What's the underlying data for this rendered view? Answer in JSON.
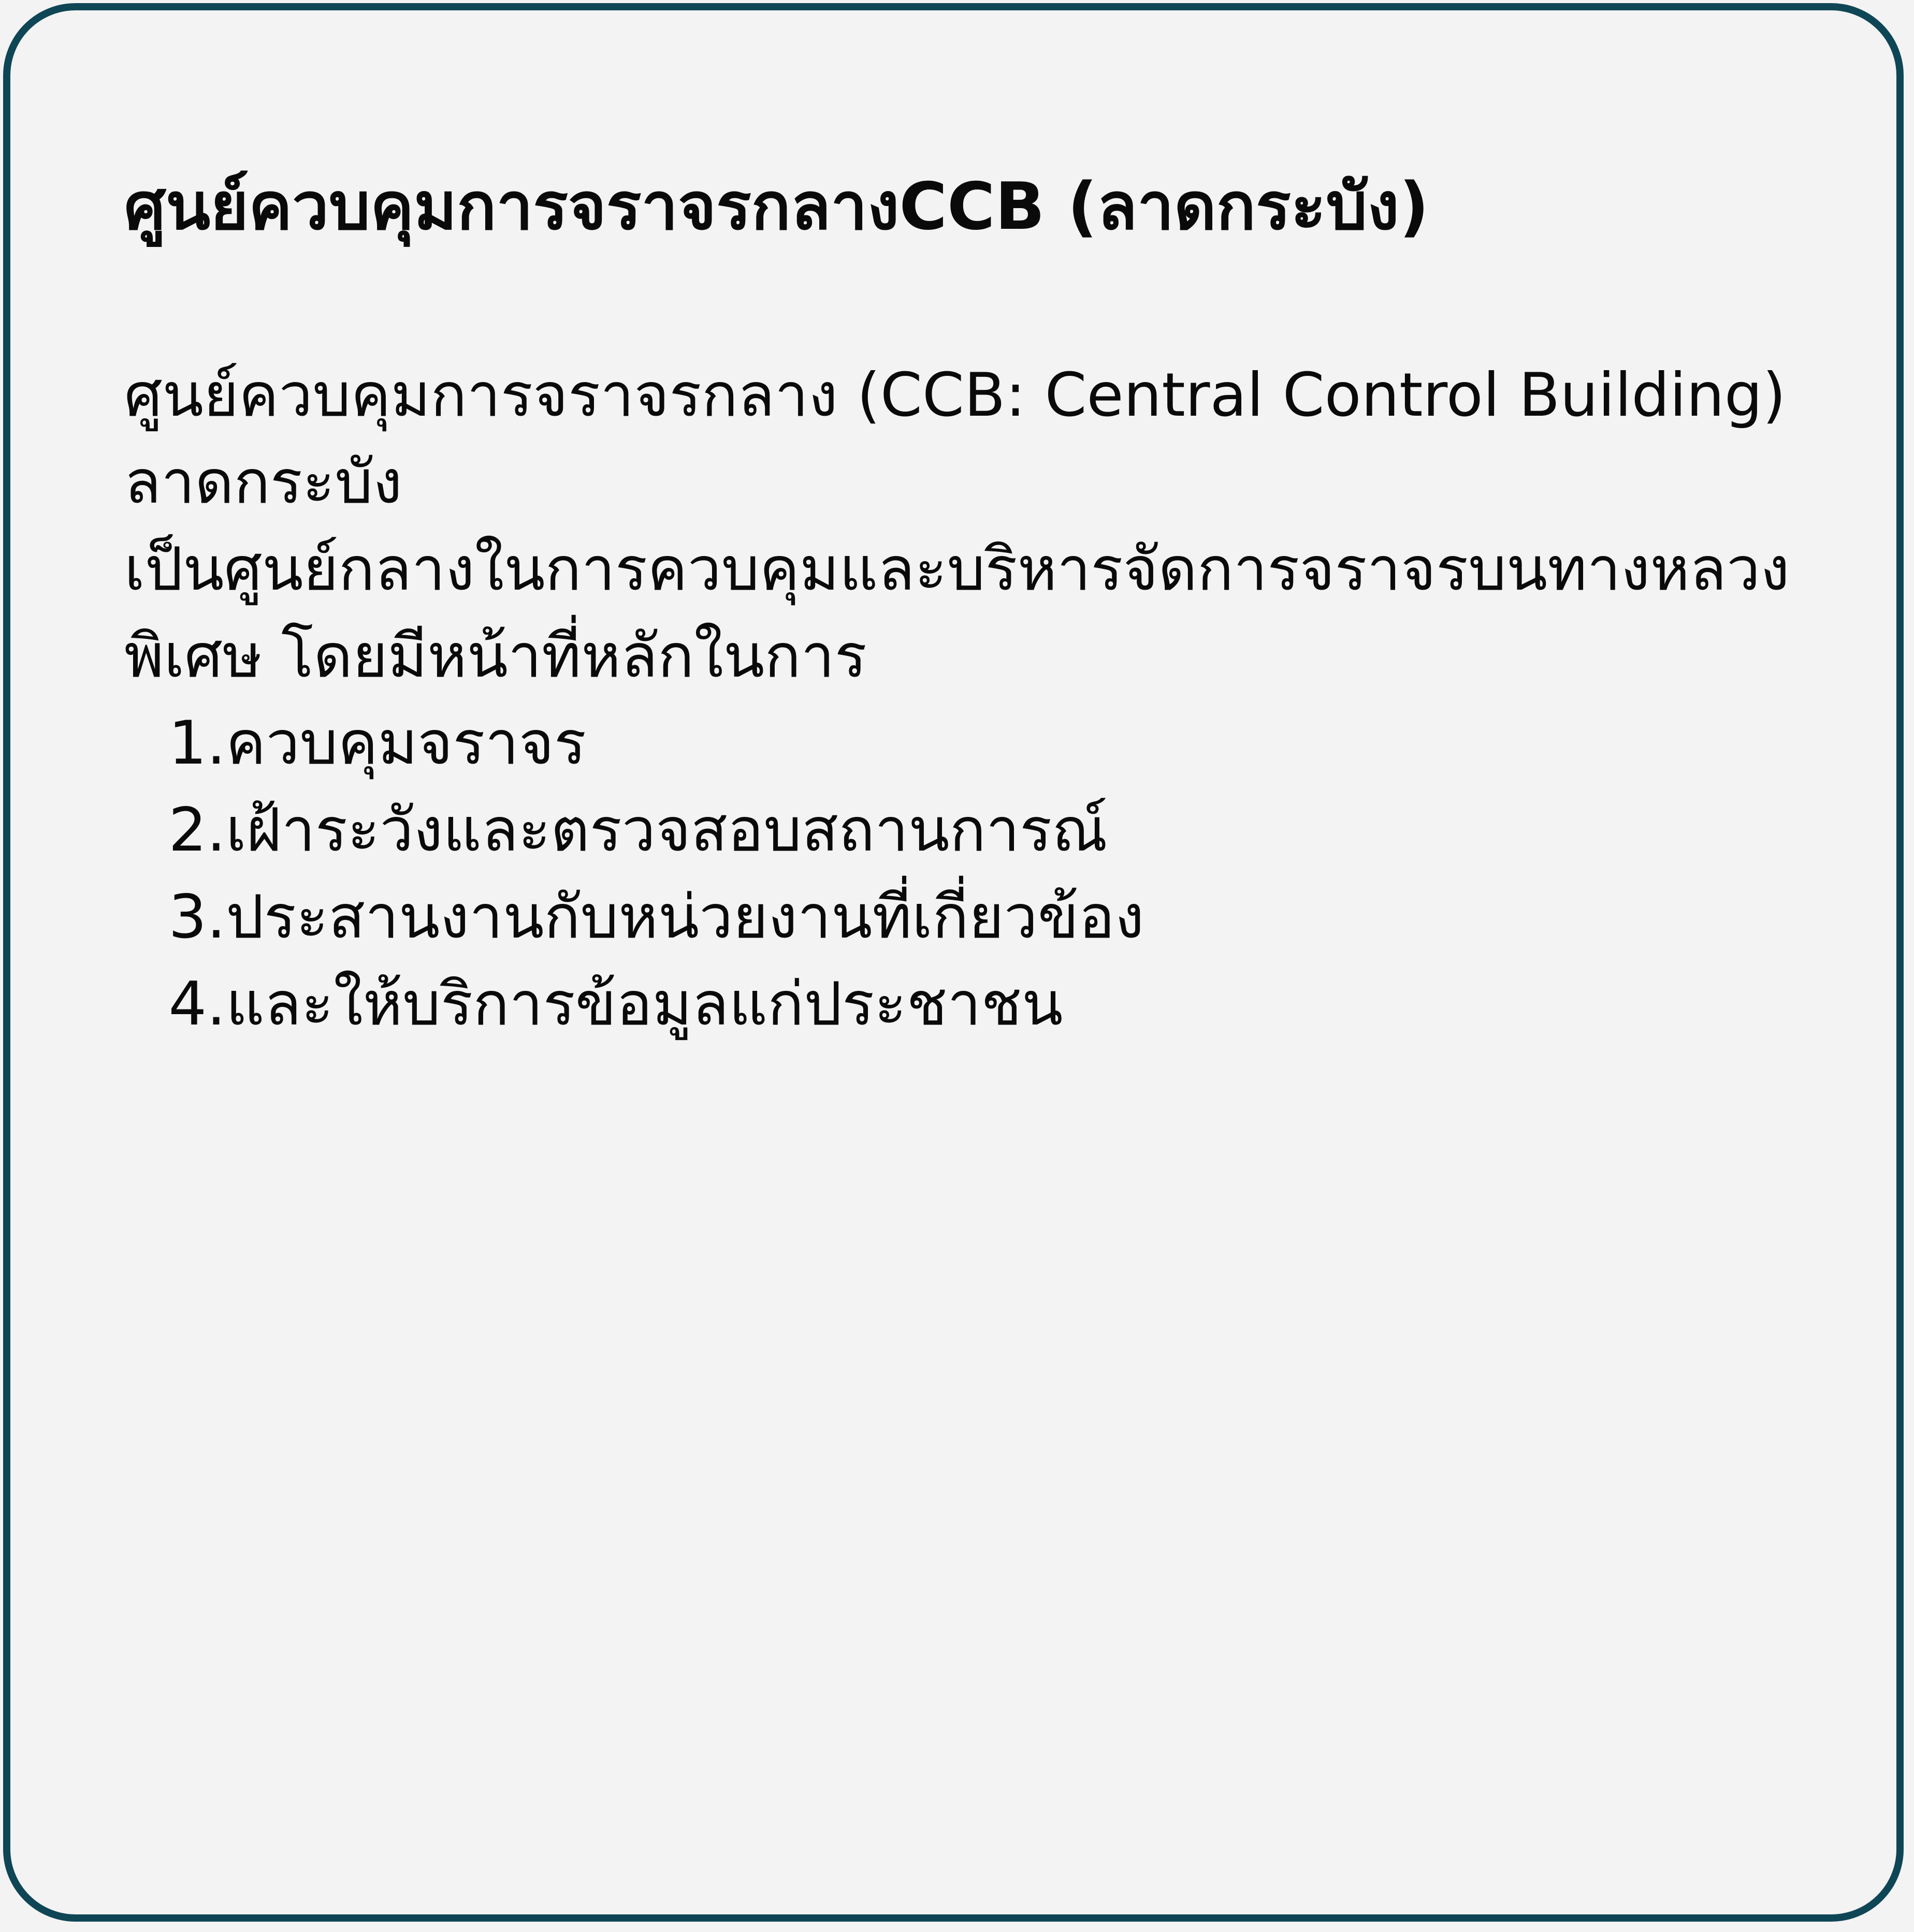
{
  "card": {
    "title": "ศูนย์ควบคุมการจราจรกลางCCB (ลาดกระบัง)",
    "paragraph_lines": [
      "ศูนย์ควบคุมการจราจรกลาง (CCB: Central Control Building)",
      "ลาดกระบัง",
      "เป็นศูนย์กลางในการควบคุมและบริหารจัดการจราจรบนทางหลวง",
      "พิเศษ โดยมีหน้าที่หลักในการ"
    ],
    "duties": [
      {
        "num": "1.",
        "text": "ควบคุมจราจร"
      },
      {
        "num": "2.",
        "text": "เฝ้าระวังและตรวจสอบสถานการณ์"
      },
      {
        "num": "3.",
        "text": "ประสานงานกับหน่วยงานที่เกี่ยวข้อง"
      },
      {
        "num": "4.",
        "text": "และให้บริการข้อมูลแก่ประชาชน"
      }
    ],
    "colors": {
      "border": "#0f4656",
      "background": "#f3f3f3",
      "text": "#0a0a0a"
    }
  }
}
